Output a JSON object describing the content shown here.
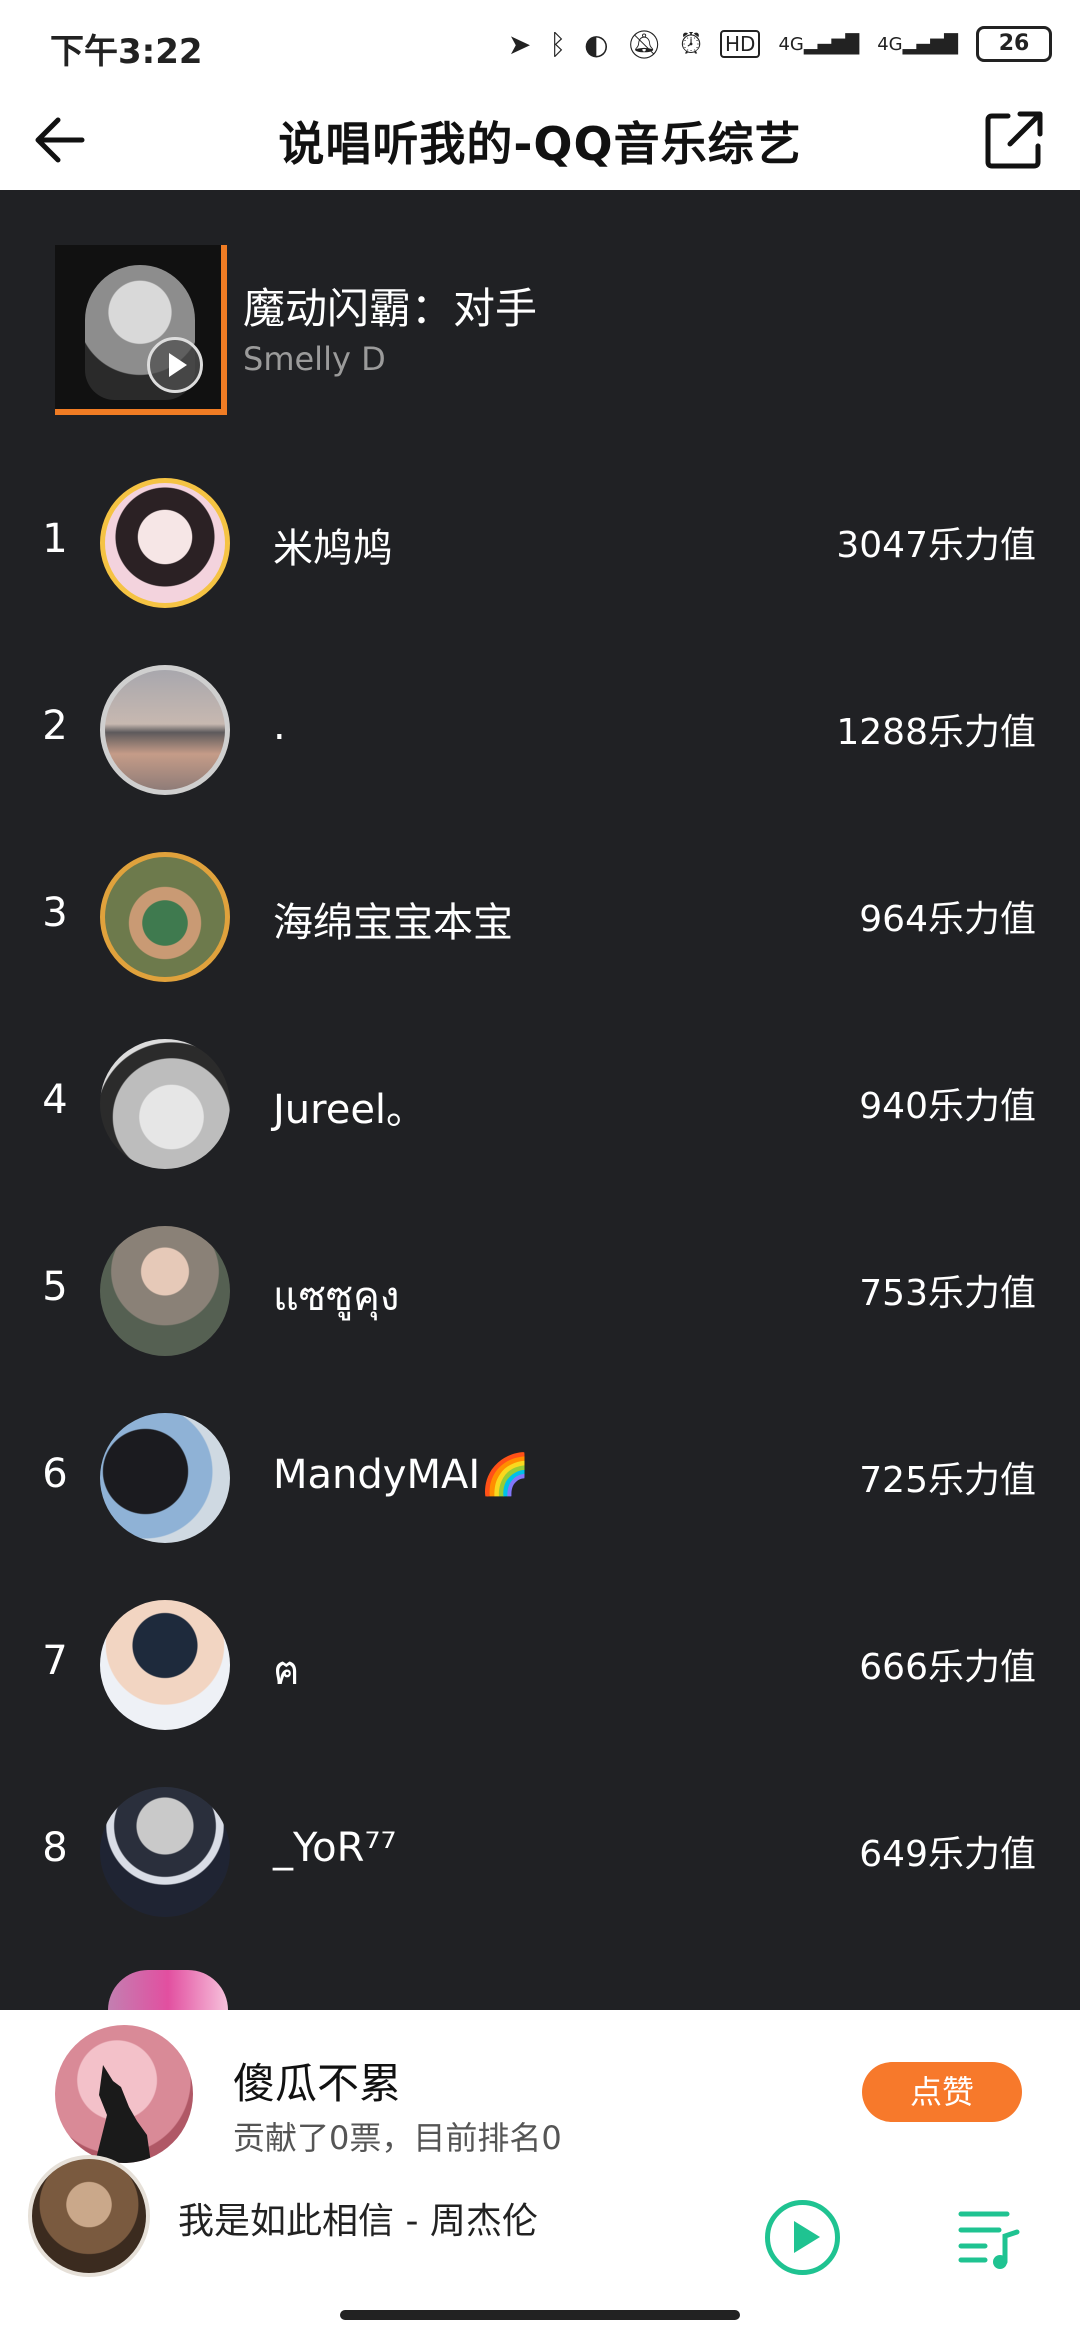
{
  "status_bar": {
    "time": "下午3:22",
    "battery": "26",
    "network_1": "4G",
    "network_2": "4G"
  },
  "header": {
    "title": "说唱听我的-QQ音乐综艺",
    "back_icon": "arrow-left-icon",
    "share_icon": "share-external-icon"
  },
  "song": {
    "title": "魔动闪霸：对手",
    "artist": "Smelly D"
  },
  "ranking": [
    {
      "rank": "1",
      "name": "米鸠鸠",
      "score": "3047乐力值",
      "ring": "#f5c343"
    },
    {
      "rank": "2",
      "name": ".",
      "score": "1288乐力值",
      "ring": "#cfcfcf"
    },
    {
      "rank": "3",
      "name": "海绵宝宝本宝",
      "score": "964乐力值",
      "ring": "#e0a23c"
    },
    {
      "rank": "4",
      "name": "Jureel。",
      "score": "940乐力值",
      "ring": ""
    },
    {
      "rank": "5",
      "name": "แซซูคุง",
      "score": "753乐力值",
      "ring": ""
    },
    {
      "rank": "6",
      "name": "MandyMAI🌈",
      "score": "725乐力值",
      "ring": ""
    },
    {
      "rank": "7",
      "name": "ฅ",
      "score": "666乐力值",
      "ring": ""
    },
    {
      "rank": "8",
      "name": "_YoR⁷⁷",
      "score": "649乐力值",
      "ring": ""
    }
  ],
  "vote_bar": {
    "name": "傻瓜不累",
    "sub": "贡献了0票，目前排名0",
    "button": "点赞"
  },
  "player": {
    "track": "我是如此相信 - 周杰伦"
  },
  "colors": {
    "accent_orange": "#f7792b",
    "play_green": "#1fc391",
    "background": "#202124"
  }
}
